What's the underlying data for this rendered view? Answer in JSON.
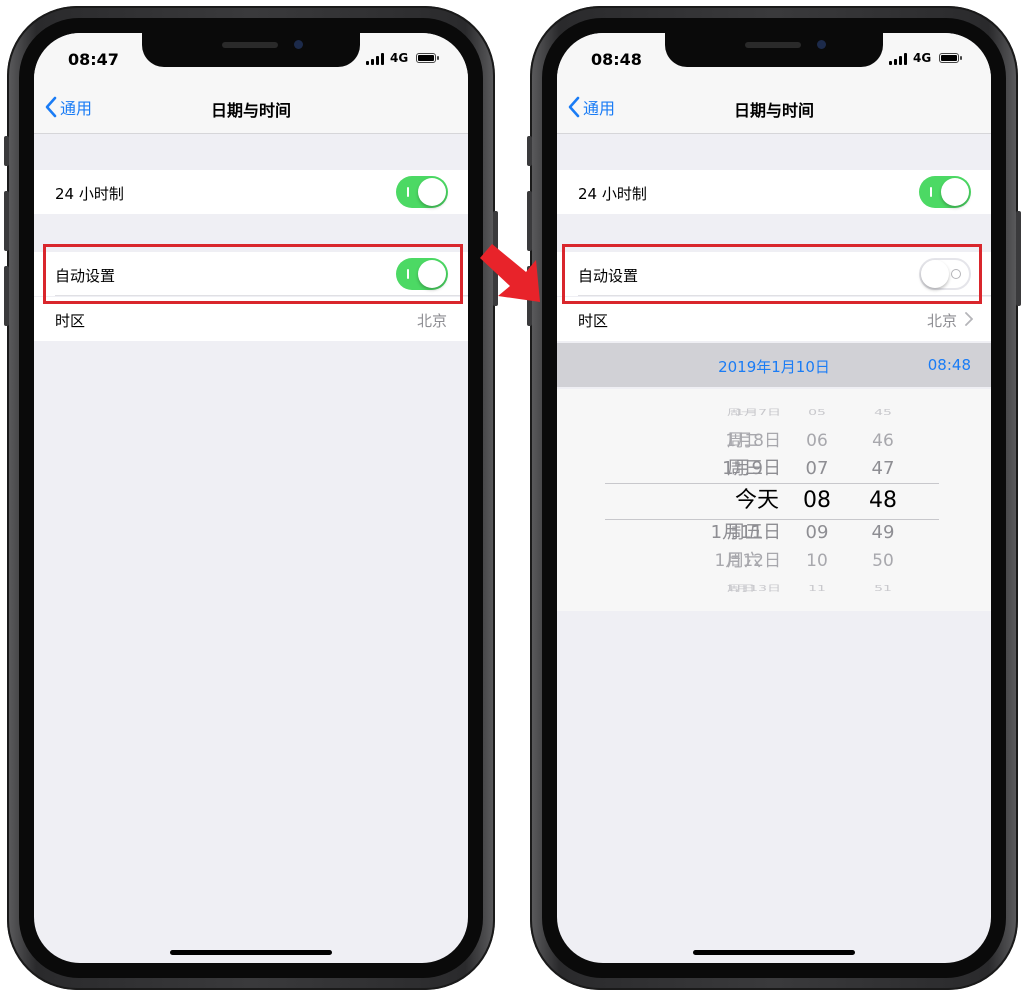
{
  "left_screen": {
    "status": {
      "time": "08:47",
      "network": "4G"
    },
    "nav": {
      "back_label": "通用",
      "title": "日期与时间"
    },
    "rows": {
      "hour24_label": "24 小时制",
      "auto_label": "自动设置",
      "timezone_label": "时区",
      "timezone_value": "北京"
    },
    "toggles": {
      "hour24": "on",
      "auto": "on"
    }
  },
  "right_screen": {
    "status": {
      "time": "08:48",
      "network": "4G"
    },
    "nav": {
      "back_label": "通用",
      "title": "日期与时间"
    },
    "rows": {
      "hour24_label": "24 小时制",
      "auto_label": "自动设置",
      "timezone_label": "时区",
      "timezone_value": "北京"
    },
    "toggles": {
      "hour24": "on",
      "auto": "off"
    },
    "datetime": {
      "date": "2019年1月10日",
      "time": "08:48"
    },
    "picker": {
      "rows": [
        {
          "date": "1月7日",
          "day": "周一",
          "hour": "05",
          "minute": "45"
        },
        {
          "date": "1月8日",
          "day": "周二",
          "hour": "06",
          "minute": "46"
        },
        {
          "date": "1月9日",
          "day": "周三",
          "hour": "07",
          "minute": "47"
        },
        {
          "date": "今天",
          "day": "",
          "hour": "08",
          "minute": "48"
        },
        {
          "date": "1月11日",
          "day": "周五",
          "hour": "09",
          "minute": "49"
        },
        {
          "date": "1月12日",
          "day": "周六",
          "hour": "10",
          "minute": "50"
        },
        {
          "date": "1月13日",
          "day": "周日",
          "hour": "11",
          "minute": "51"
        }
      ]
    }
  },
  "colors": {
    "accent": "#1a7cf5",
    "toggle_on": "#4cd964",
    "highlight": "#d9262c"
  }
}
